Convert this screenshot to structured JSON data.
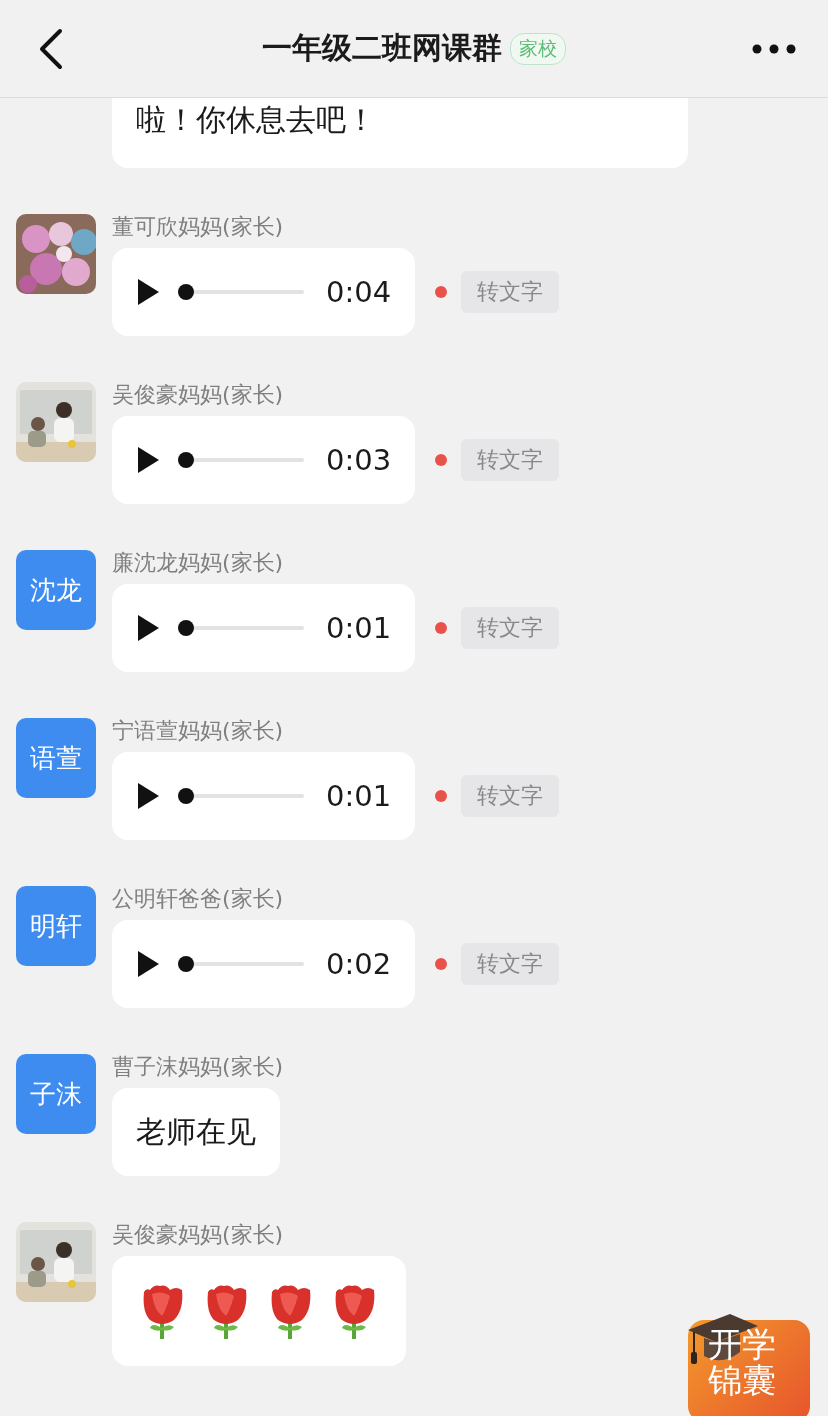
{
  "header": {
    "title": "一年级二班网课群",
    "tag": "家校"
  },
  "top_message": {
    "text": "啦！你休息去吧！"
  },
  "messages": [
    {
      "sender": "董可欣妈妈(家长)",
      "kind": "voice",
      "duration": "0:04",
      "level": 0,
      "unread": true,
      "action": "转文字"
    },
    {
      "sender": "吴俊豪妈妈(家长)",
      "kind": "voice",
      "duration": "0:03",
      "level": 0,
      "unread": true,
      "action": "转文字"
    },
    {
      "sender": "廉沈龙妈妈(家长)",
      "avatar": {
        "kind": "initials",
        "text": "沈龙"
      },
      "kind": "voice",
      "duration": "0:01",
      "level": 0,
      "unread": true,
      "action": "转文字"
    },
    {
      "sender": "宁语萱妈妈(家长)",
      "avatar": {
        "kind": "initials",
        "text": "语萱"
      },
      "kind": "voice",
      "duration": "0:01",
      "level": 0,
      "unread": true,
      "action": "转文字"
    },
    {
      "sender": "公明轩爸爸(家长)",
      "avatar": {
        "kind": "initials",
        "text": "明轩"
      },
      "kind": "voice",
      "duration": "0:02",
      "level": 0,
      "unread": true,
      "action": "转文字"
    },
    {
      "sender": "曹子沫妈妈(家长)",
      "avatar": {
        "kind": "initials",
        "text": "子沫"
      },
      "kind": "text",
      "text": "老师在见"
    },
    {
      "sender": "吴俊豪妈妈(家长)",
      "kind": "stickers",
      "stickers": [
        {
          "kind": "rose"
        },
        {
          "kind": "rose"
        },
        {
          "kind": "rose"
        },
        {
          "kind": "rose"
        }
      ]
    }
  ],
  "floating_badge": {
    "text": "开学锦囊"
  }
}
